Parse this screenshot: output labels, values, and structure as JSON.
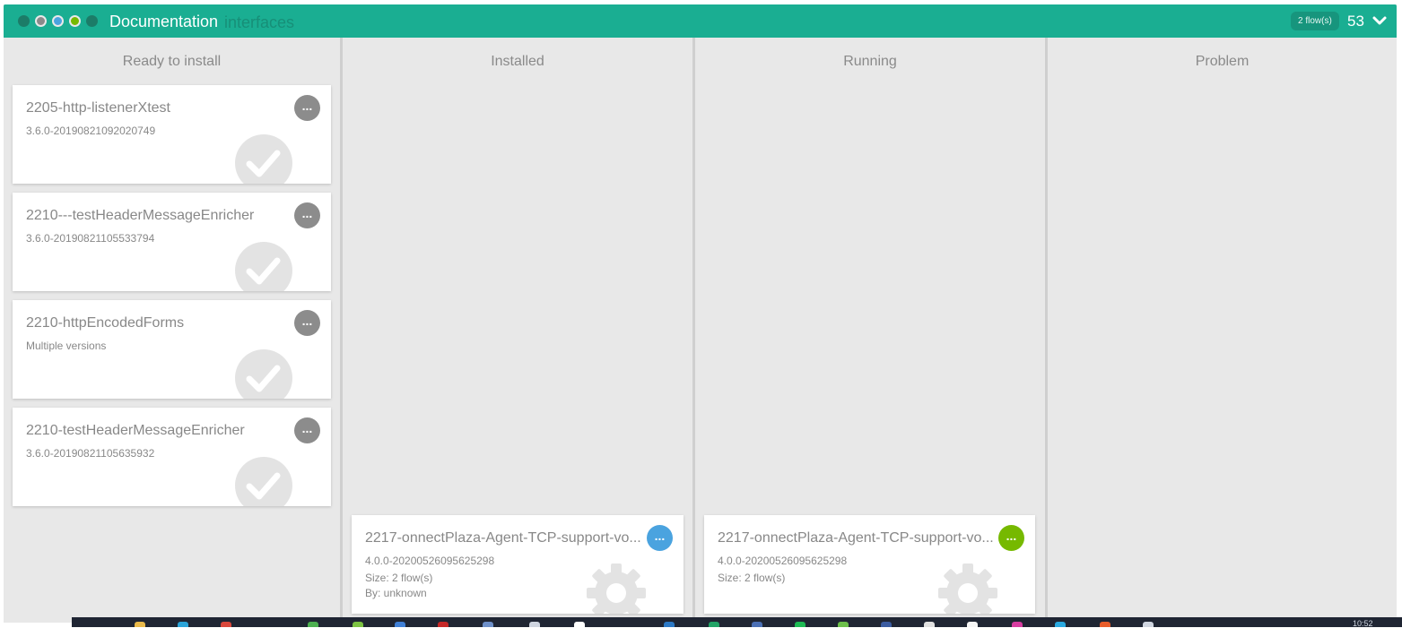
{
  "header": {
    "title": "Documentation",
    "subtitle": "interfaces",
    "flows_badge": "2 flow(s)",
    "count": "53"
  },
  "columns": [
    {
      "title": "Ready to install",
      "cards": [
        {
          "name": "2205-http-listenerXtest",
          "version": "3.6.0-20190821092020749"
        },
        {
          "name": "2210---testHeaderMessageEnricher",
          "version": "3.6.0-20190821105533794"
        },
        {
          "name": "2210-httpEncodedForms",
          "version": "Multiple versions"
        },
        {
          "name": "2210-testHeaderMessageEnricher",
          "version": "3.6.0-20190821105635932"
        }
      ]
    },
    {
      "title": "Installed",
      "cards": [
        {
          "name": "2217-onnectPlaza-Agent-TCP-support-vo...",
          "version": "4.0.0-20200526095625298",
          "size": "Size: 2 flow(s)",
          "by": "By: unknown"
        }
      ]
    },
    {
      "title": "Running",
      "cards": [
        {
          "name": "2217-onnectPlaza-Agent-TCP-support-vo...",
          "version": "4.0.0-20200526095625298",
          "size": "Size: 2 flow(s)"
        }
      ]
    },
    {
      "title": "Problem",
      "cards": []
    }
  ],
  "menu_label": "...",
  "colors": {
    "header": "#1aae92",
    "ready_menu": "#8c8c8c",
    "installed_menu": "#4aa3df",
    "running_menu": "#76b900"
  },
  "taskbar": {
    "clock": "10:52"
  }
}
